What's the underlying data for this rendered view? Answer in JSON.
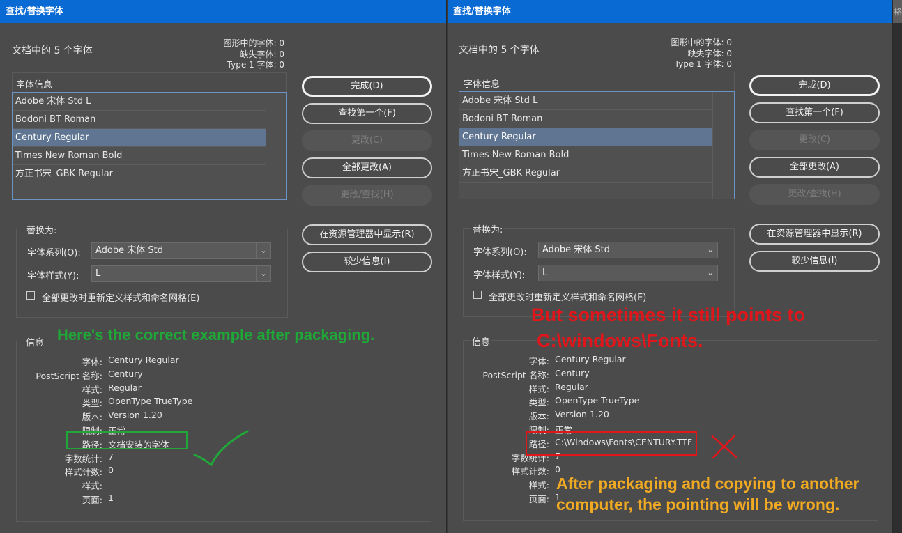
{
  "dialogs": [
    {
      "title": "查找/替换字体",
      "doc_fonts_title": "文档中的 5 个字体",
      "counts": [
        "图形中的字体: 0",
        "缺失字体: 0",
        "Type 1 字体: 0"
      ],
      "font_info_label": "字体信息",
      "fonts": [
        "Adobe 宋体 Std L",
        "Bodoni BT Roman",
        "Century Regular",
        "Times New Roman Bold",
        "方正书宋_GBK Regular"
      ],
      "selected_font_index": 2,
      "buttons": {
        "done": "完成(D)",
        "find_first": "查找第一个(F)",
        "change": "更改(C)",
        "change_all": "全部更改(A)",
        "change_find": "更改/查找(H)",
        "reveal_in_explorer": "在资源管理器中显示(R)",
        "less_info": "较少信息(I)"
      },
      "replace_label": "替换为:",
      "font_family_label": "字体系列(O):",
      "font_family_value": "Adobe 宋体 Std",
      "font_style_label": "字体样式(Y):",
      "font_style_value": "L",
      "redefine_label": "全部更改时重新定义样式和命名网格(E)",
      "redefine_checked": false,
      "info_label": "信息",
      "info": [
        {
          "label": "字体:",
          "value": "Century Regular"
        },
        {
          "label": "PostScript 名称:",
          "value": "Century"
        },
        {
          "label": "样式:",
          "value": "Regular"
        },
        {
          "label": "类型:",
          "value": "OpenType TrueType"
        },
        {
          "label": "版本:",
          "value": "Version 1.20"
        },
        {
          "label": "限制:",
          "value": "正常"
        },
        {
          "label": "路径:",
          "value": "文档安装的字体"
        },
        {
          "label": "字数统计:",
          "value": "7"
        },
        {
          "label": "样式计数:",
          "value": "0"
        },
        {
          "label": "样式:",
          "value": ""
        },
        {
          "label": "页面:",
          "value": "1"
        }
      ]
    },
    {
      "title": "查找/替换字体",
      "doc_fonts_title": "文档中的 5 个字体",
      "counts": [
        "图形中的字体: 0",
        "缺失字体: 0",
        "Type 1 字体: 0"
      ],
      "font_info_label": "字体信息",
      "fonts": [
        "Adobe 宋体 Std L",
        "Bodoni BT Roman",
        "Century Regular",
        "Times New Roman Bold",
        "方正书宋_GBK Regular"
      ],
      "selected_font_index": 2,
      "buttons": {
        "done": "完成(D)",
        "find_first": "查找第一个(F)",
        "change": "更改(C)",
        "change_all": "全部更改(A)",
        "change_find": "更改/查找(H)",
        "reveal_in_explorer": "在资源管理器中显示(R)",
        "less_info": "较少信息(I)"
      },
      "replace_label": "替换为:",
      "font_family_label": "字体系列(O):",
      "font_family_value": "Adobe 宋体 Std",
      "font_style_label": "字体样式(Y):",
      "font_style_value": "L",
      "redefine_label": "全部更改时重新定义样式和命名网格(E)",
      "redefine_checked": false,
      "info_label": "信息",
      "info": [
        {
          "label": "字体:",
          "value": "Century Regular"
        },
        {
          "label": "PostScript 名称:",
          "value": "Century"
        },
        {
          "label": "样式:",
          "value": "Regular"
        },
        {
          "label": "类型:",
          "value": "OpenType TrueType"
        },
        {
          "label": "版本:",
          "value": "Version 1.20"
        },
        {
          "label": "限制:",
          "value": "正常"
        },
        {
          "label": "路径:",
          "value": "C:\\Windows\\Fonts\\CENTURY.TTF"
        },
        {
          "label": "字数统计:",
          "value": "7"
        },
        {
          "label": "样式计数:",
          "value": "0"
        },
        {
          "label": "样式:",
          "value": ""
        },
        {
          "label": "页面:",
          "value": "1"
        }
      ]
    }
  ],
  "annotations": {
    "green_note": "Here's the correct example after packaging.",
    "red_note_line1": "But sometimes it still points to",
    "red_note_line2": "C:\\windows\\Fonts.",
    "orange_note_line1": "After packaging and copying to another",
    "orange_note_line2": "computer, the pointing will be wrong.",
    "colors": {
      "green": "#1fa838",
      "red": "#e1161b",
      "orange": "#f0a922"
    }
  },
  "edge_strip_glyph": "格"
}
